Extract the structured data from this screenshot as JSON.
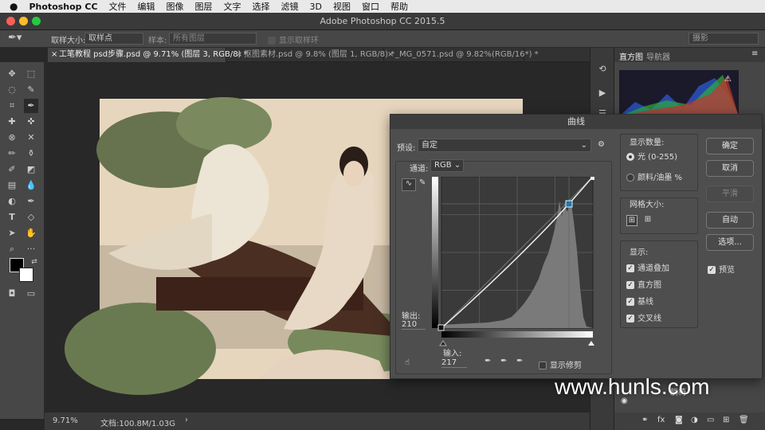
{
  "menubar": {
    "app": "Photoshop CC",
    "items": [
      "文件",
      "编辑",
      "图像",
      "图层",
      "文字",
      "选择",
      "滤镜",
      "3D",
      "视图",
      "窗口",
      "帮助"
    ]
  },
  "window": {
    "title": "Adobe Photoshop CC 2015.5"
  },
  "options": {
    "sample_size_label": "取样大小:",
    "sample_size_value": "取样点",
    "sample_label": "样本:",
    "sample_value": "所有图层",
    "show_ring": "显示取样环",
    "workspace": "摄影"
  },
  "tabs": [
    {
      "label": "工笔教程 psd步骤.psd @ 9.71% (图层 3, RGB/8) *",
      "close": "×"
    },
    {
      "label": "抠图素材.psd @ 9.8% (图层 1, RGB/8) *",
      "close": "×"
    },
    {
      "label": "_MG_0571.psd @ 9.82%(RGB/16*) *",
      "close": "×"
    }
  ],
  "status": {
    "zoom": "9.71%",
    "doc": "文档:100.8M/1.03G",
    "arrow": "›"
  },
  "right_panel": {
    "tab_histogram": "直方图",
    "tab_navigator": "导航器",
    "layer_name": "躺椅"
  },
  "curves": {
    "title": "曲线",
    "preset_label": "预设:",
    "preset_value": "自定",
    "channel_label": "通道:",
    "channel_value": "RGB",
    "output_label": "输出:",
    "output_value": "210",
    "input_label": "输入:",
    "input_value": "217",
    "show_clipping": "显示修剪",
    "show_amount_label": "显示数量:",
    "light_option": "光 (0-255)",
    "pigment_option": "颜料/油墨 %",
    "grid_size_label": "网格大小:",
    "show_label": "显示:",
    "checks": [
      "通道叠加",
      "直方图",
      "基线",
      "交叉线"
    ],
    "buttons": {
      "ok": "确定",
      "cancel": "取消",
      "smooth": "平滑",
      "auto": "自动",
      "options": "选项..."
    },
    "preview": "预览",
    "point": {
      "input": 217,
      "output": 210
    }
  },
  "watermark": "www.hunls.com",
  "colors": {
    "accent": "#2f6fb4",
    "dialog": "#4e4e4e",
    "canvas_bg": "#e7d6be"
  }
}
